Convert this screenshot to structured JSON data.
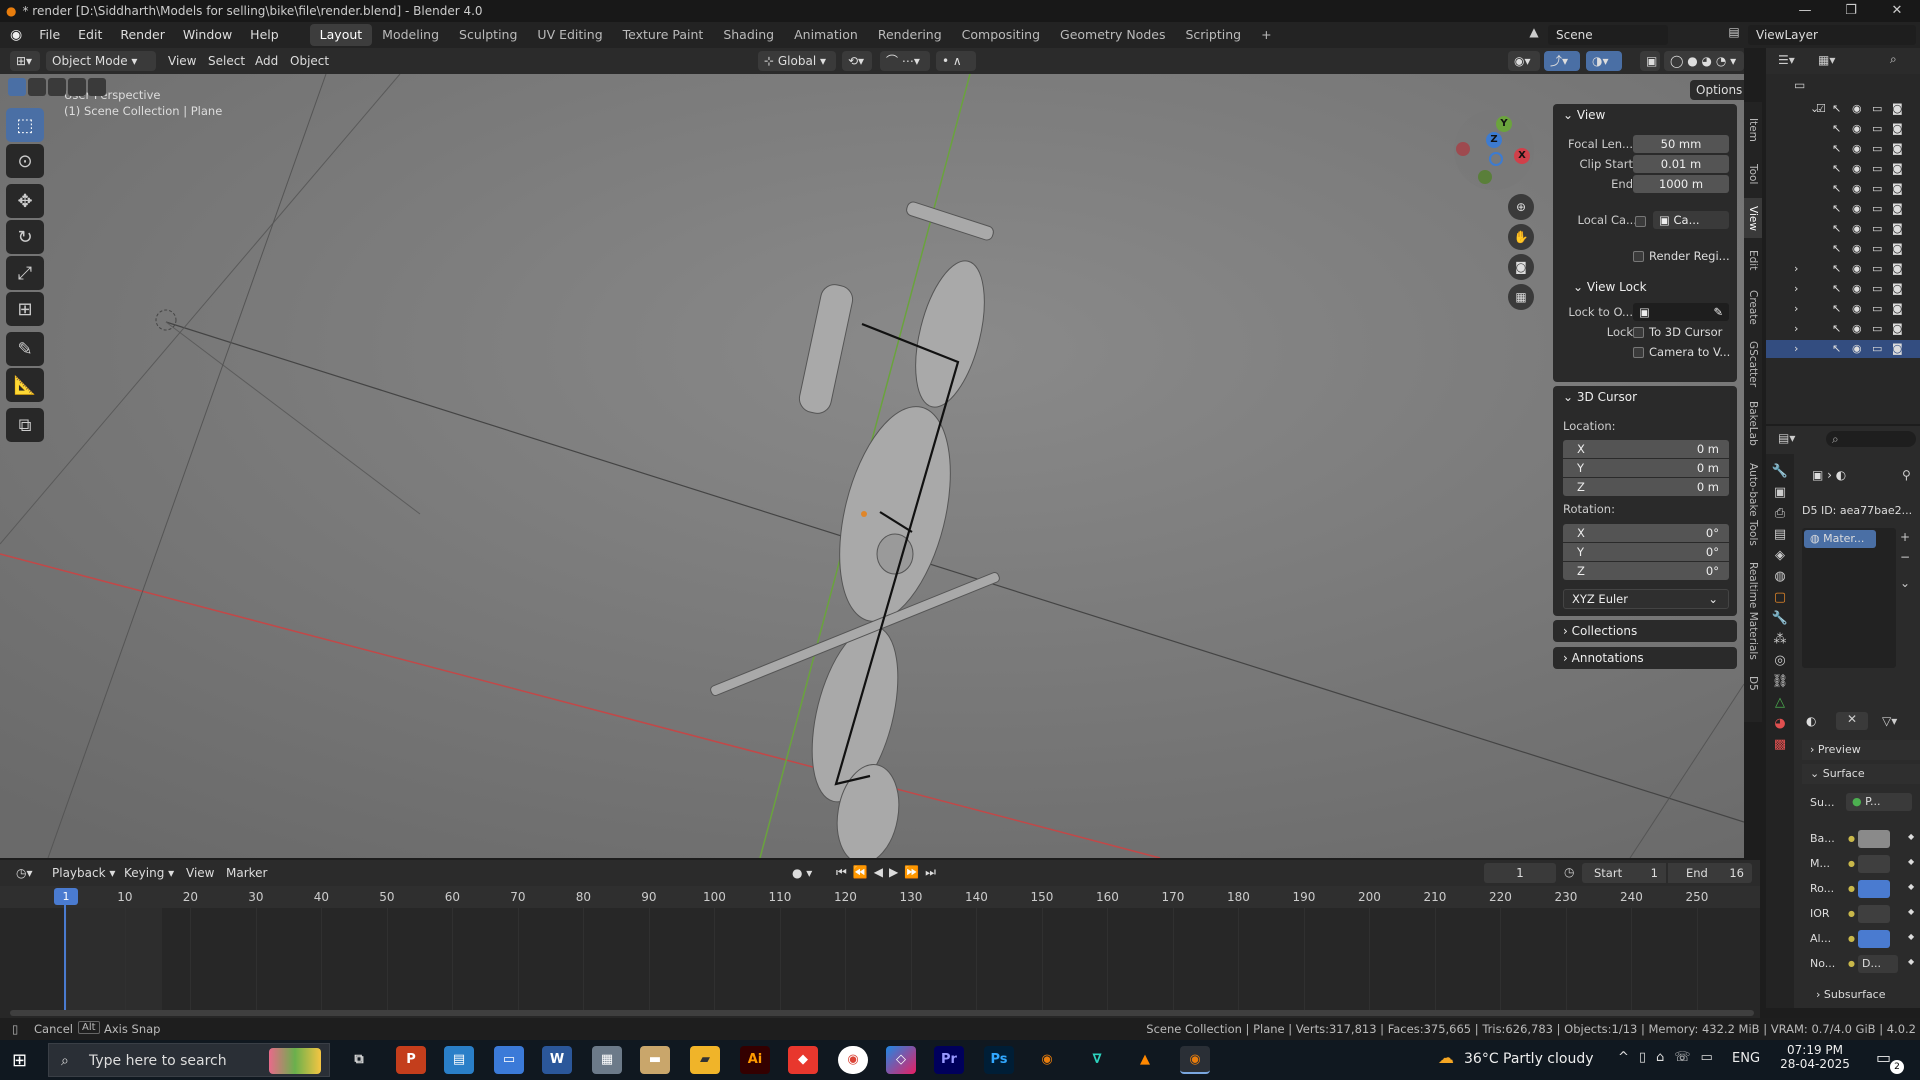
{
  "window": {
    "title": "* render [D:\\Siddharth\\Models for selling\\bike\\file\\render.blend] - Blender 4.0",
    "minimize": "—",
    "maximize": "❐",
    "close": "✕"
  },
  "menubar": {
    "menus": [
      "File",
      "Edit",
      "Render",
      "Window",
      "Help"
    ],
    "workspaces": [
      "Layout",
      "Modeling",
      "Sculpting",
      "UV Editing",
      "Texture Paint",
      "Shading",
      "Animation",
      "Rendering",
      "Compositing",
      "Geometry Nodes",
      "Scripting"
    ],
    "active_workspace": "Layout",
    "add_tab": "+",
    "scene": "Scene",
    "view_layer": "ViewLayer"
  },
  "viewport_header": {
    "mode": "Object Mode",
    "menus": [
      "View",
      "Select",
      "Add",
      "Object"
    ],
    "transform_orientation": "Global",
    "options": "Options"
  },
  "viewport": {
    "perspective": "User Perspective",
    "collection_info": "(1) Scene Collection | Plane",
    "gizmo_axes": {
      "x": "X",
      "y": "Y",
      "z": "Z"
    }
  },
  "npanel": {
    "view": {
      "header": "View",
      "focal_label": "Focal Len...",
      "focal_value": "50 mm",
      "clip_start_label": "Clip Start",
      "clip_start_value": "0.01 m",
      "end_label": "End",
      "end_value": "1000 m",
      "local_camera_label": "Local Ca...",
      "local_camera_value": "Ca...",
      "render_region": "Render Regi..."
    },
    "view_lock": {
      "header": "View Lock",
      "lock_to_label": "Lock to O...",
      "lock_label": "Lock",
      "to_cursor": "To 3D Cursor",
      "camera_to_view": "Camera to V..."
    },
    "cursor": {
      "header": "3D Cursor",
      "location_label": "Location:",
      "loc": [
        {
          "axis": "X",
          "value": "0 m"
        },
        {
          "axis": "Y",
          "value": "0 m"
        },
        {
          "axis": "Z",
          "value": "0 m"
        }
      ],
      "rotation_label": "Rotation:",
      "rot": [
        {
          "axis": "X",
          "value": "0°"
        },
        {
          "axis": "Y",
          "value": "0°"
        },
        {
          "axis": "Z",
          "value": "0°"
        }
      ],
      "rotation_mode": "XYZ Euler"
    },
    "collections": "Collections",
    "annotations": "Annotations",
    "tabs": [
      "Item",
      "Tool",
      "View",
      "Edit",
      "Create",
      "GScatter",
      "BakeLab",
      "Auto-bake Tools",
      "Realtime Materials",
      "D5"
    ]
  },
  "properties": {
    "d5_id": "D5 ID: aea77bae2...",
    "material_slot": "Mater...",
    "preview": "Preview",
    "surface": "Surface",
    "surface_label": "Su...",
    "surface_value": "P...",
    "rows": [
      {
        "label": "Ba...",
        "color": "#8a8a8a"
      },
      {
        "label": "M...",
        "color": "#3f3f3f"
      },
      {
        "label": "Ro...",
        "color": "#4a7bd0"
      },
      {
        "label": "IOR",
        "color": "#3f3f3f"
      },
      {
        "label": "Al...",
        "color": "#4a7bd0"
      },
      {
        "label": "No...",
        "value": "D..."
      }
    ],
    "subsurface": "Subsurface"
  },
  "timeline": {
    "menus": [
      "Playback",
      "Keying",
      "View",
      "Marker"
    ],
    "current_frame": "1",
    "start_label": "Start",
    "start_value": "1",
    "end_label": "End",
    "end_value": "16",
    "ruler": [
      "1",
      "10",
      "20",
      "30",
      "40",
      "50",
      "60",
      "70",
      "80",
      "90",
      "100",
      "110",
      "120",
      "130",
      "140",
      "150",
      "160",
      "170",
      "180",
      "190",
      "200",
      "210",
      "220",
      "230",
      "240",
      "250"
    ]
  },
  "statusbar": {
    "cancel": "Cancel",
    "alt_key": "Alt",
    "axis_snap": "Axis Snap",
    "stats": "Scene Collection | Plane | Verts:317,813 | Faces:375,665 | Tris:626,783 | Objects:1/13 | Memory: 432.2 MiB | VRAM: 0.7/4.0 GiB | 4.0.2"
  },
  "taskbar": {
    "search_placeholder": "Type here to search",
    "weather": "36°C  Partly cloudy",
    "language": "ENG",
    "time": "07:19 PM",
    "date": "28-04-2025",
    "notif_count": "2",
    "apps": [
      "P",
      "W",
      "Ai",
      "Pr",
      "Ps"
    ]
  }
}
